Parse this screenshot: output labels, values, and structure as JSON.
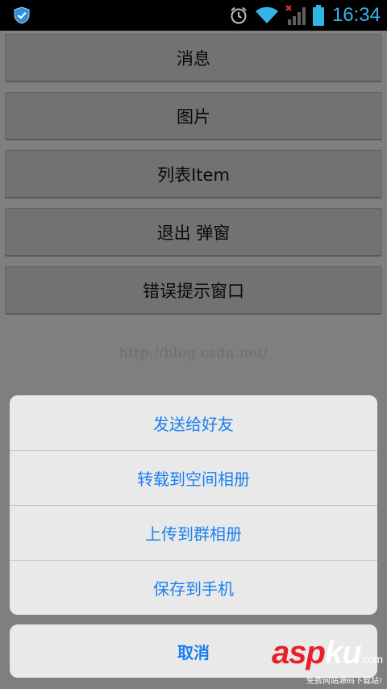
{
  "status_bar": {
    "time": "16:34",
    "accent_color": "#33b5e5",
    "icons": [
      "shield-icon",
      "alarm-icon",
      "wifi-icon",
      "signal-no-service-icon",
      "battery-icon"
    ]
  },
  "main": {
    "buttons": [
      {
        "label": "消息"
      },
      {
        "label": "图片"
      },
      {
        "label": "列表Item"
      },
      {
        "label": "退出 弹窗"
      },
      {
        "label": "错误提示窗口"
      }
    ],
    "watermark": "http://blog.csdn.net/"
  },
  "action_sheet": {
    "items": [
      {
        "label": "发送给好友"
      },
      {
        "label": "转载到空间相册"
      },
      {
        "label": "上传到群相册"
      },
      {
        "label": "保存到手机"
      }
    ],
    "cancel_label": "取消",
    "text_color": "#1a7ff0"
  },
  "corner_logo": {
    "part1": "asp",
    "part2": "ku",
    "domain": ".com",
    "tagline": "免费网站源码下载站!"
  }
}
